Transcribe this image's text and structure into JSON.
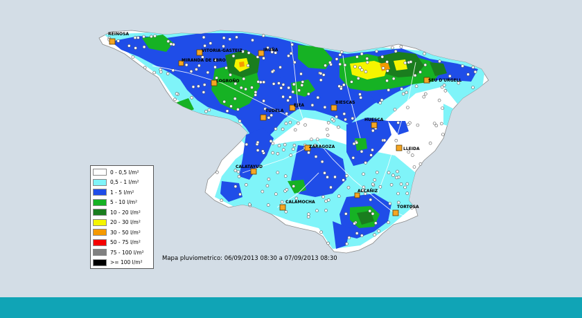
{
  "colors": {
    "background": "#d3dde6",
    "footer": "#10a4b6",
    "map_base": "#ffffff",
    "city_marker": "#f5a623",
    "station": "#ffffff"
  },
  "legend": [
    {
      "label": "0 - 0,5 l/m²",
      "color": "#ffffff"
    },
    {
      "label": "0,5 - 1 l/m²",
      "color": "#7ff4f9"
    },
    {
      "label": "1 - 5 l/m²",
      "color": "#1f4de8"
    },
    {
      "label": "5 - 10 l/m²",
      "color": "#16b224"
    },
    {
      "label": "10 - 20 l/m²",
      "color": "#1a7d1e"
    },
    {
      "label": "20 - 30 l/m²",
      "color": "#f5f500"
    },
    {
      "label": "30 - 50 l/m²",
      "color": "#f59a00"
    },
    {
      "label": "50 - 75 l/m²",
      "color": "#f50000"
    },
    {
      "label": "75 - 100 l/m²",
      "color": "#808080"
    },
    {
      "label": ">= 100 l/m²",
      "color": "#000000"
    }
  ],
  "caption": "Mapa pluviometrico: 06/09/2013 08:30 a 07/09/2013 08:30",
  "cities": [
    {
      "name": "REINOSA"
    },
    {
      "name": "VITORIA-GASTEIZ"
    },
    {
      "name": "IRUÑA"
    },
    {
      "name": "MIRANDA DE EBRO"
    },
    {
      "name": "LOGROÑO"
    },
    {
      "name": "TUDELA"
    },
    {
      "name": "EJEA"
    },
    {
      "name": "BIESCAS"
    },
    {
      "name": "SEU D'URGELL"
    },
    {
      "name": "HUESCA"
    },
    {
      "name": "ZARAGOZA"
    },
    {
      "name": "LLEIDA"
    },
    {
      "name": "CALATAYUD"
    },
    {
      "name": "ALCAÑIZ"
    },
    {
      "name": "CALAMOCHA"
    },
    {
      "name": "TORTOSA"
    }
  ]
}
